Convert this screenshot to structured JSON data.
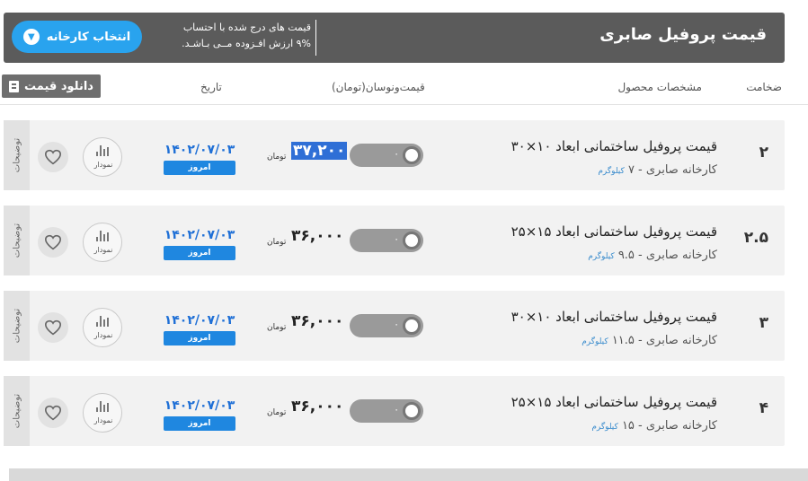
{
  "header": {
    "title": "قیمت پروفیل صابری",
    "vat_line1": "قیمت های درج شده با احتساب",
    "vat_line2": "۹% ارزش افـزوده مــی بـاشـد.",
    "select_factory": "انتخاب کارخانه"
  },
  "columns": {
    "thickness": "ضخامت",
    "product": "مشخصات محصول",
    "price_change": "قیمت‌ونوسان(تومان)",
    "date": "تاریخ",
    "download": "دانلود قیمت"
  },
  "rows": [
    {
      "thickness": "۲",
      "name": "قیمت پروفیل ساختمانی ابعاد ۱۰×۳۰",
      "factory": "کارخانه صابری - ",
      "weight": "۷",
      "weight_unit": "کیلوگرم",
      "toggle_value": "۰",
      "price": "۳۷,۲۰۰",
      "unit": "تومان",
      "date": "۱۴۰۲/۰۷/۰۳",
      "today": "امروز",
      "chart": "نمودار",
      "side": "توضیحات"
    },
    {
      "thickness": "۲.۵",
      "name": "قیمت پروفیل ساختمانی ابعاد ۱۵×۲۵",
      "factory": "کارخانه صابری - ",
      "weight": "۹.۵",
      "weight_unit": "کیلوگرم",
      "toggle_value": "۰",
      "price": "۳۶,۰۰۰",
      "unit": "تومان",
      "date": "۱۴۰۲/۰۷/۰۳",
      "today": "امروز",
      "chart": "نمودار",
      "side": "توضیحات"
    },
    {
      "thickness": "۳",
      "name": "قیمت پروفیل ساختمانی ابعاد ۱۰×۳۰",
      "factory": "کارخانه صابری - ",
      "weight": "۱۱.۵",
      "weight_unit": "کیلوگرم",
      "toggle_value": "۰",
      "price": "۳۶,۰۰۰",
      "unit": "تومان",
      "date": "۱۴۰۲/۰۷/۰۳",
      "today": "امروز",
      "chart": "نمودار",
      "side": "توضیحات"
    },
    {
      "thickness": "۴",
      "name": "قیمت پروفیل ساختمانی ابعاد ۱۵×۲۵",
      "factory": "کارخانه صابری - ",
      "weight": "۱۵",
      "weight_unit": "کیلوگرم",
      "toggle_value": "۰",
      "price": "۳۶,۰۰۰",
      "unit": "تومان",
      "date": "۱۴۰۲/۰۷/۰۳",
      "today": "امروز",
      "chart": "نمودار",
      "side": "توضیحات"
    }
  ],
  "colors": {
    "header_bg": "#5b5b5b",
    "accent": "#29a3ee",
    "date": "#1e6fd6"
  },
  "icons": {
    "dropdown": "chevron-down-icon",
    "download": "file-icon",
    "chart": "bar-chart-icon",
    "favorite": "heart-icon"
  }
}
